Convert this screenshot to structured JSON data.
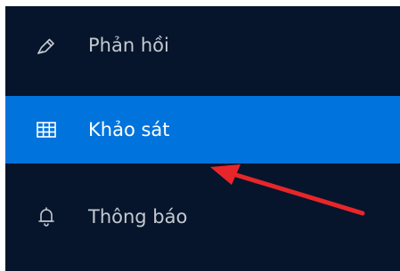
{
  "menu": {
    "items": [
      {
        "label": "Phản hồi",
        "icon": "feedback-icon",
        "active": false
      },
      {
        "label": "Khảo sát",
        "icon": "table-icon",
        "active": true
      },
      {
        "label": "Thông báo",
        "icon": "bell-icon",
        "active": false
      }
    ]
  },
  "colors": {
    "sidebar_bg": "#06152b",
    "active_bg": "#0073dc",
    "text": "#c4c9d0",
    "active_text": "#ffffff",
    "annotation_arrow": "#e8262a"
  },
  "annotation": {
    "type": "arrow",
    "points_to": "Khảo sát"
  }
}
